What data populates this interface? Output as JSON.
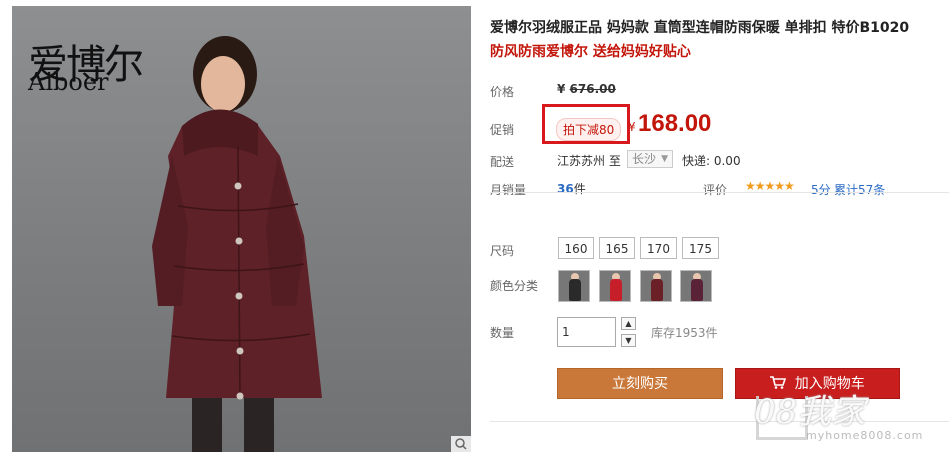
{
  "product_image": {
    "brand_cn": "爱博尔",
    "brand_en": "Aiboer",
    "zoom_icon": "magnifier-icon",
    "coat_color": "#5e2127"
  },
  "info": {
    "title": "爱博尔羽绒服正品 妈妈款 直筒型连帽防雨保暖 单排扣 特价B1020",
    "subtitle": "防风防雨爱博尔 送给妈妈好贴心",
    "price_label": "价格",
    "original_price_currency": "¥",
    "original_price": "676.00",
    "promo_label": "促销",
    "promo_tag": "拍下减80",
    "price_currency": "¥",
    "price": "168.00",
    "shipping_label": "配送",
    "ship_from": "江苏苏州",
    "ship_to_word": "至",
    "ship_to_city": "长沙",
    "express": "快递: 0.00",
    "monthly_sales_label": "月销量",
    "monthly_sales_count": "36",
    "monthly_sales_unit": "件",
    "rating_label": "评价",
    "stars": "★★★★★",
    "score": "5分",
    "reviews": "累计57条"
  },
  "options": {
    "size_label": "尺码",
    "sizes": [
      "160",
      "165",
      "170",
      "175"
    ],
    "color_label": "颜色分类",
    "color_swatches": [
      "#2b2a2a",
      "#c61f2a",
      "#6b1f26",
      "#5a2236"
    ],
    "quantity_label": "数量",
    "quantity_value": "1",
    "stock": "库存1953件"
  },
  "actions": {
    "buy_now": "立刻购买",
    "add_to_cart": "加入购物车",
    "cart_icon": "cart-icon"
  },
  "watermark": {
    "main": "08我家",
    "url": "myhome8008.com"
  },
  "colors": {
    "price_red": "#c3160b",
    "buy_orange": "#c9783a",
    "cart_red": "#c81e1e",
    "link_blue": "#2b6cc4",
    "highlight_box": "#d7181c"
  }
}
